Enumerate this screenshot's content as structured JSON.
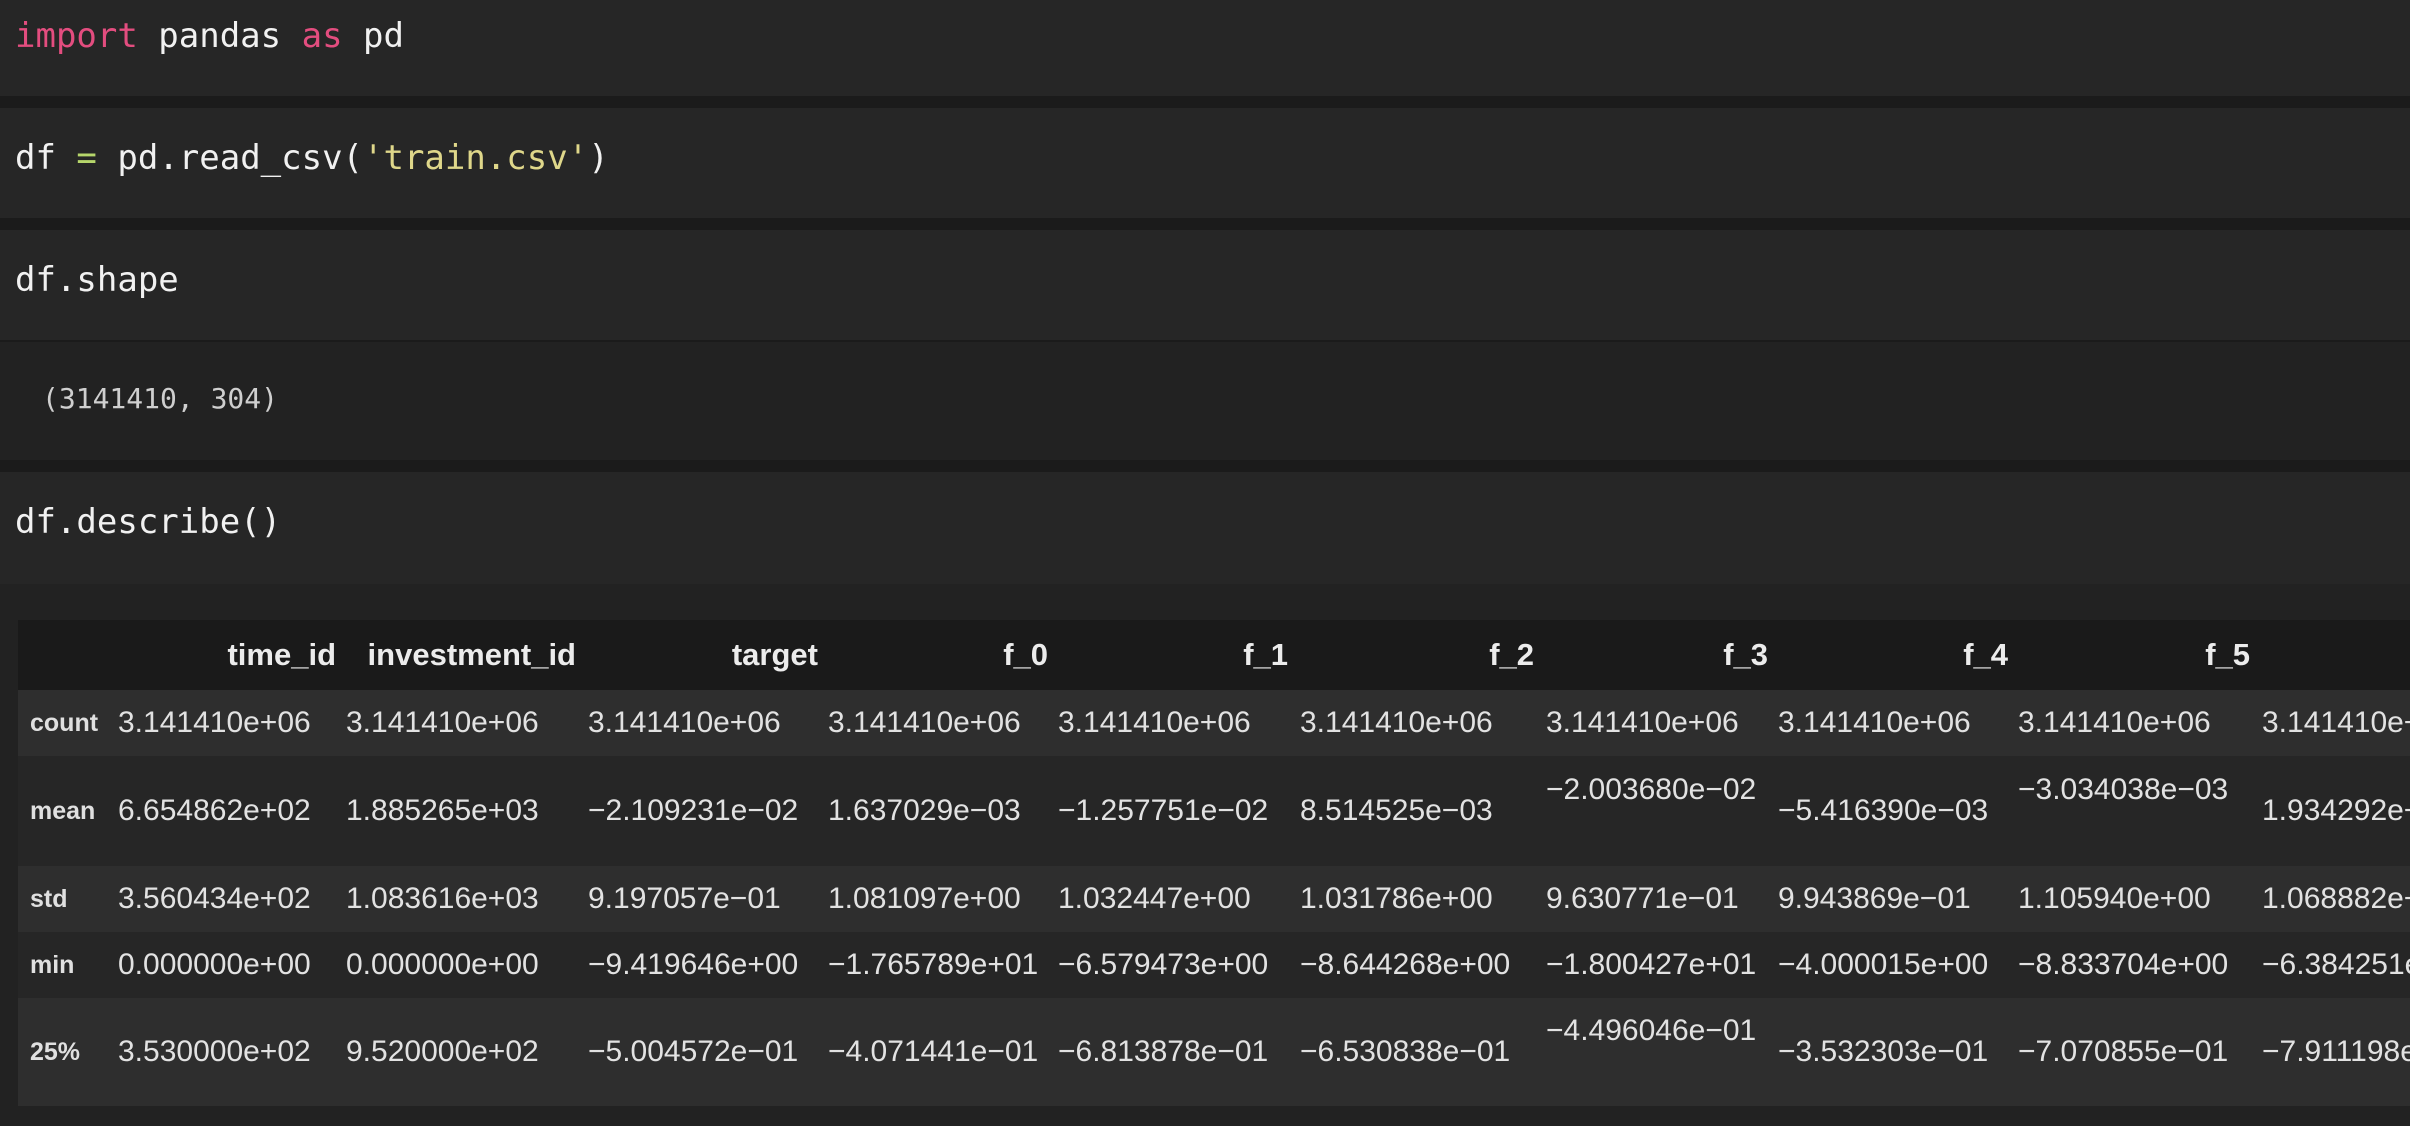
{
  "cells": {
    "c1": {
      "kw1": "import",
      "mid": " pandas ",
      "kw2": "as",
      "end": " pd"
    },
    "c2": {
      "lhs": "df ",
      "op": "=",
      "mid": " pd.read_csv(",
      "str": "'train.csv'",
      "end": ")"
    },
    "c3": {
      "code": "df.shape",
      "output": "(3141410, 304)"
    },
    "c4": {
      "code": "df.describe()"
    }
  },
  "table": {
    "columns": [
      "time_id",
      "investment_id",
      "target",
      "f_0",
      "f_1",
      "f_2",
      "f_3",
      "f_4",
      "f_5"
    ],
    "rows": [
      {
        "index": "count",
        "values": [
          "3.141410e+06",
          "3.141410e+06",
          "3.141410e+06",
          "3.141410e+06",
          "3.141410e+06",
          "3.141410e+06",
          "3.141410e+06",
          "3.141410e+06",
          "3.141410e+06",
          "3.141410e+"
        ]
      },
      {
        "index": "mean",
        "values": [
          "6.654862e+02",
          "1.885265e+03",
          "−2.109231e−02",
          "1.637029e−03",
          "−1.257751e−02",
          "8.514525e−03",
          "−2.003680e−02",
          "−5.416390e−03",
          "−3.034038e−03",
          "1.934292e−"
        ]
      },
      {
        "index": "std",
        "values": [
          "3.560434e+02",
          "1.083616e+03",
          "9.197057e−01",
          "1.081097e+00",
          "1.032447e+00",
          "1.031786e+00",
          "9.630771e−01",
          "9.943869e−01",
          "1.105940e+00",
          "1.068882e−"
        ]
      },
      {
        "index": "min",
        "values": [
          "0.000000e+00",
          "0.000000e+00",
          "−9.419646e+00",
          "−1.765789e+01",
          "−6.579473e+00",
          "−8.644268e+00",
          "−1.800427e+01",
          "−4.000015e+00",
          "−8.833704e+00",
          "−6.384251e"
        ]
      },
      {
        "index": "25%",
        "values": [
          "3.530000e+02",
          "9.520000e+02",
          "−5.004572e−01",
          "−4.071441e−01",
          "−6.813878e−01",
          "−6.530838e−01",
          "−4.496046e−01",
          "−3.532303e−01",
          "−7.070855e−01",
          "−7.911198e"
        ]
      }
    ]
  }
}
